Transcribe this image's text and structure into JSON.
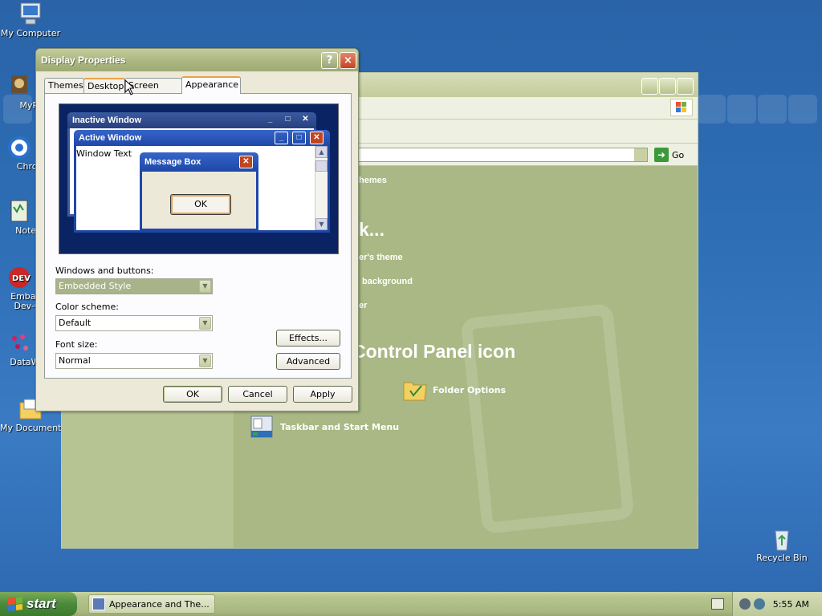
{
  "desktop": {
    "icons": [
      {
        "label": "My Computer"
      },
      {
        "label": "MyPa"
      },
      {
        "label": "Chrom"
      },
      {
        "label": "Notepa"
      },
      {
        "label": "Embarc",
        "label2": "Dev-C"
      },
      {
        "label": "DataWa"
      },
      {
        "label": "My Documents"
      },
      {
        "label": "Recycle Bin"
      }
    ]
  },
  "control_panel": {
    "address_go": "Go",
    "sidebar_link": "hemes",
    "pick_task_heading": "k...",
    "tasks": [
      "er's theme",
      "background",
      "er"
    ],
    "pick_icon_heading": "Control Panel icon",
    "items": [
      "Folder Options",
      "Taskbar and Start Menu"
    ]
  },
  "dialog": {
    "title": "Display Properties",
    "help_glyph": "?",
    "close_glyph": "×",
    "tabs": [
      "Themes",
      "Desktop",
      "Screen Saver",
      "Appearance"
    ],
    "active_tab": "Appearance",
    "preview": {
      "inactive_title": "Inactive Window",
      "active_title": "Active Window",
      "window_text": "Window Text",
      "message_box_title": "Message Box",
      "ok_label": "OK"
    },
    "windows_buttons_label": "Windows and buttons:",
    "windows_buttons_value": "Embedded Style",
    "color_scheme_label": "Color scheme:",
    "color_scheme_value": "Default",
    "font_size_label": "Font size:",
    "font_size_value": "Normal",
    "effects_label": "Effects...",
    "advanced_label": "Advanced",
    "ok_label": "OK",
    "cancel_label": "Cancel",
    "apply_label": "Apply"
  },
  "taskbar": {
    "start_label": "start",
    "task_button_label": "Appearance and The...",
    "clock": "5:55 AM"
  },
  "colors": {
    "desktop_blue": "#2e6fb6",
    "cp_green": "#a9b884",
    "title_olive": "#adb882",
    "close_red": "#c24420",
    "preview_navy": "#0a2463"
  }
}
